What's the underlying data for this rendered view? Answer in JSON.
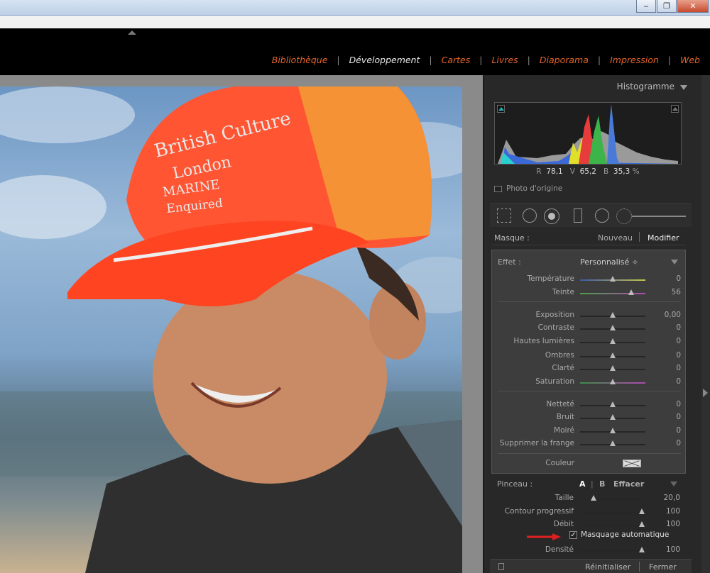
{
  "window": {
    "min_icon": "minimize-icon",
    "max_icon": "maximize-icon",
    "close_icon": "close-icon"
  },
  "modules": [
    {
      "label": "Bibliothèque",
      "active": false
    },
    {
      "label": "Développement",
      "active": true
    },
    {
      "label": "Cartes",
      "active": false
    },
    {
      "label": "Livres",
      "active": false
    },
    {
      "label": "Diaporama",
      "active": false
    },
    {
      "label": "Impression",
      "active": false
    },
    {
      "label": "Web",
      "active": false
    }
  ],
  "colors": {
    "module_inactive": "#e0632a",
    "module_active": "#e6e6e6",
    "panel_bg": "#282828"
  },
  "histogram": {
    "title": "Histogramme",
    "r_label": "R",
    "r_value": "78,1",
    "v_label": "V",
    "v_value": "65,2",
    "b_label": "B",
    "b_value": "35,3",
    "unit": "%",
    "photo_origine": "Photo d'origine"
  },
  "masque": {
    "label": "Masque :",
    "nouveau": "Nouveau",
    "modifier": "Modifier"
  },
  "effet": {
    "label": "Effet :",
    "value": "Personnalisé ÷",
    "sliders": [
      {
        "name": "Température",
        "value": "0",
        "pos": 0.5
      },
      {
        "name": "Teinte",
        "value": "56",
        "pos": 0.78
      },
      {
        "name": "Exposition",
        "value": "0,00",
        "pos": 0.5
      },
      {
        "name": "Contraste",
        "value": "0",
        "pos": 0.5
      },
      {
        "name": "Hautes lumières",
        "value": "0",
        "pos": 0.5
      },
      {
        "name": "Ombres",
        "value": "0",
        "pos": 0.5
      },
      {
        "name": "Clarté",
        "value": "0",
        "pos": 0.5
      },
      {
        "name": "Saturation",
        "value": "0",
        "pos": 0.5
      },
      {
        "name": "Netteté",
        "value": "0",
        "pos": 0.5
      },
      {
        "name": "Bruit",
        "value": "0",
        "pos": 0.5
      },
      {
        "name": "Moiré",
        "value": "0",
        "pos": 0.5
      },
      {
        "name": "Supprimer la frange",
        "value": "0",
        "pos": 0.5
      }
    ],
    "couleur": "Couleur"
  },
  "pinceau": {
    "label": "Pinceau :",
    "a": "A",
    "sep": "|",
    "b": "B",
    "effacer": "Effacer",
    "sliders": [
      {
        "name": "Taille",
        "value": "20,0",
        "pos": 0.22
      },
      {
        "name": "Contour progressif",
        "value": "100",
        "pos": 0.96
      },
      {
        "name": "Débit",
        "value": "100",
        "pos": 0.96
      }
    ],
    "masquage_auto": "Masquage automatique",
    "masquage_checked": true,
    "densite": {
      "name": "Densité",
      "value": "100",
      "pos": 0.96
    }
  },
  "footer": {
    "reinitialiser": "Réinitialiser",
    "fermer": "Fermer"
  }
}
